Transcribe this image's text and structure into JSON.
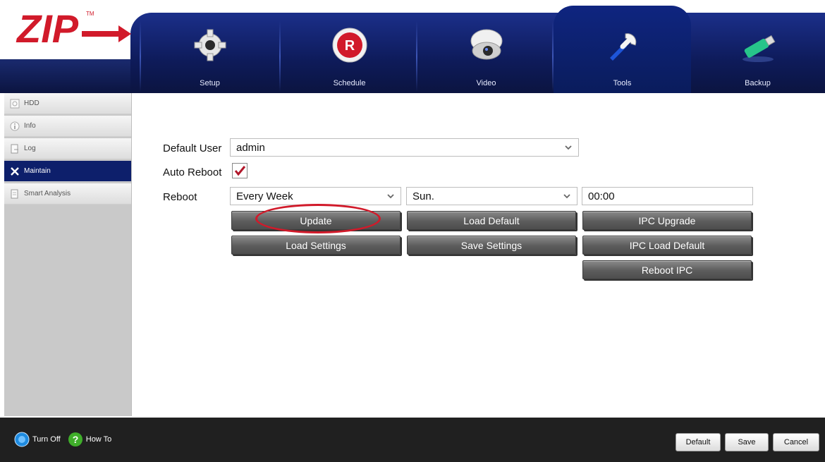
{
  "brand": {
    "logo_text": "ZIP",
    "tm": "TM",
    "colors": {
      "logo_red": "#d11a2a",
      "nav_blue": "#0d1f6b"
    }
  },
  "tabs": [
    {
      "label": "Setup",
      "icon": "gear-icon"
    },
    {
      "label": "Schedule",
      "icon": "record-icon"
    },
    {
      "label": "Video",
      "icon": "camera-icon"
    },
    {
      "label": "Tools",
      "icon": "wrench-icon",
      "active": true
    },
    {
      "label": "Backup",
      "icon": "usb-icon"
    }
  ],
  "sidebar": {
    "items": [
      {
        "label": "HDD",
        "icon": "disk-icon"
      },
      {
        "label": "Info",
        "icon": "info-icon"
      },
      {
        "label": "Log",
        "icon": "log-icon"
      },
      {
        "label": "Maintain",
        "icon": "tools-icon",
        "active": true
      },
      {
        "label": "Smart Analysis",
        "icon": "analysis-icon"
      }
    ]
  },
  "form": {
    "default_user_label": "Default User",
    "default_user_value": "admin",
    "auto_reboot_label": "Auto Reboot",
    "auto_reboot_checked": true,
    "reboot_label": "Reboot",
    "reboot_frequency": "Every Week",
    "reboot_day": "Sun.",
    "reboot_time": "00:00"
  },
  "buttons": {
    "update": "Update",
    "load_default": "Load Default",
    "ipc_upgrade": "IPC Upgrade",
    "load_settings": "Load Settings",
    "save_settings": "Save Settings",
    "ipc_load_default": "IPC Load Default",
    "reboot_ipc": "Reboot IPC"
  },
  "footer": {
    "turn_off": "Turn Off",
    "how_to": "How To",
    "default": "Default",
    "save": "Save",
    "cancel": "Cancel"
  }
}
